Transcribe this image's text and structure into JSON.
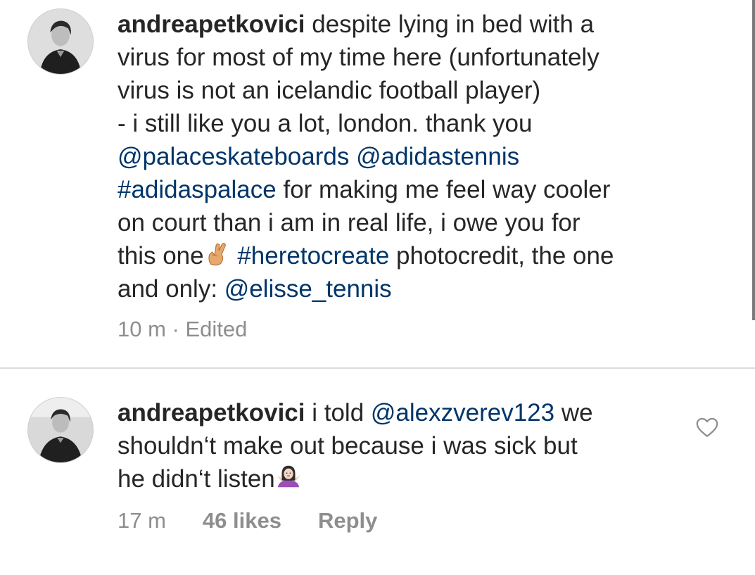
{
  "comments": [
    {
      "username": "andreapetkovici",
      "lines": [
        [
          {
            "t": "despite lying in bed with a"
          }
        ],
        [
          {
            "t": "virus for most of my time here (unfortunately"
          }
        ],
        [
          {
            "t": "virus is not an icelandic football player)"
          }
        ],
        [
          {
            "t": "- i still like you a lot, london. thank you"
          }
        ],
        [
          {
            "t": "@palaceskateboards",
            "link": true
          },
          {
            "t": " "
          },
          {
            "t": "@adidastennis",
            "link": true
          }
        ],
        [
          {
            "t": "#adidaspalace",
            "link": true
          },
          {
            "t": " for making me feel way cooler"
          }
        ],
        [
          {
            "t": "on court than i am in real life, i owe you for"
          }
        ],
        [
          {
            "t": "this one"
          },
          {
            "emoji": "crossed-fingers-emoji"
          },
          {
            "t": " "
          },
          {
            "t": "#heretocreate",
            "link": true
          },
          {
            "t": " photocredit, the one"
          }
        ],
        [
          {
            "t": "and only: "
          },
          {
            "t": "@elisse_tennis",
            "link": true
          }
        ]
      ],
      "time": "10 m",
      "separator": " · ",
      "status": "Edited"
    },
    {
      "username": "andreapetkovici",
      "lines": [
        [
          {
            "t": "i told "
          },
          {
            "t": "@alexzverev123",
            "link": true
          },
          {
            "t": " we"
          }
        ],
        [
          {
            "t": "shouldn‘t make out because i was sick but"
          }
        ],
        [
          {
            "t": "he didn‘t listen"
          },
          {
            "emoji": "woman-shrugging-emoji"
          }
        ]
      ],
      "time": "17 m",
      "likes": "46 likes",
      "reply": "Reply",
      "like_icon": "heart-outline-icon"
    }
  ],
  "colors": {
    "text": "#262626",
    "link": "#003569",
    "meta": "#8e8e8e",
    "divider": "#dbdbdb"
  }
}
